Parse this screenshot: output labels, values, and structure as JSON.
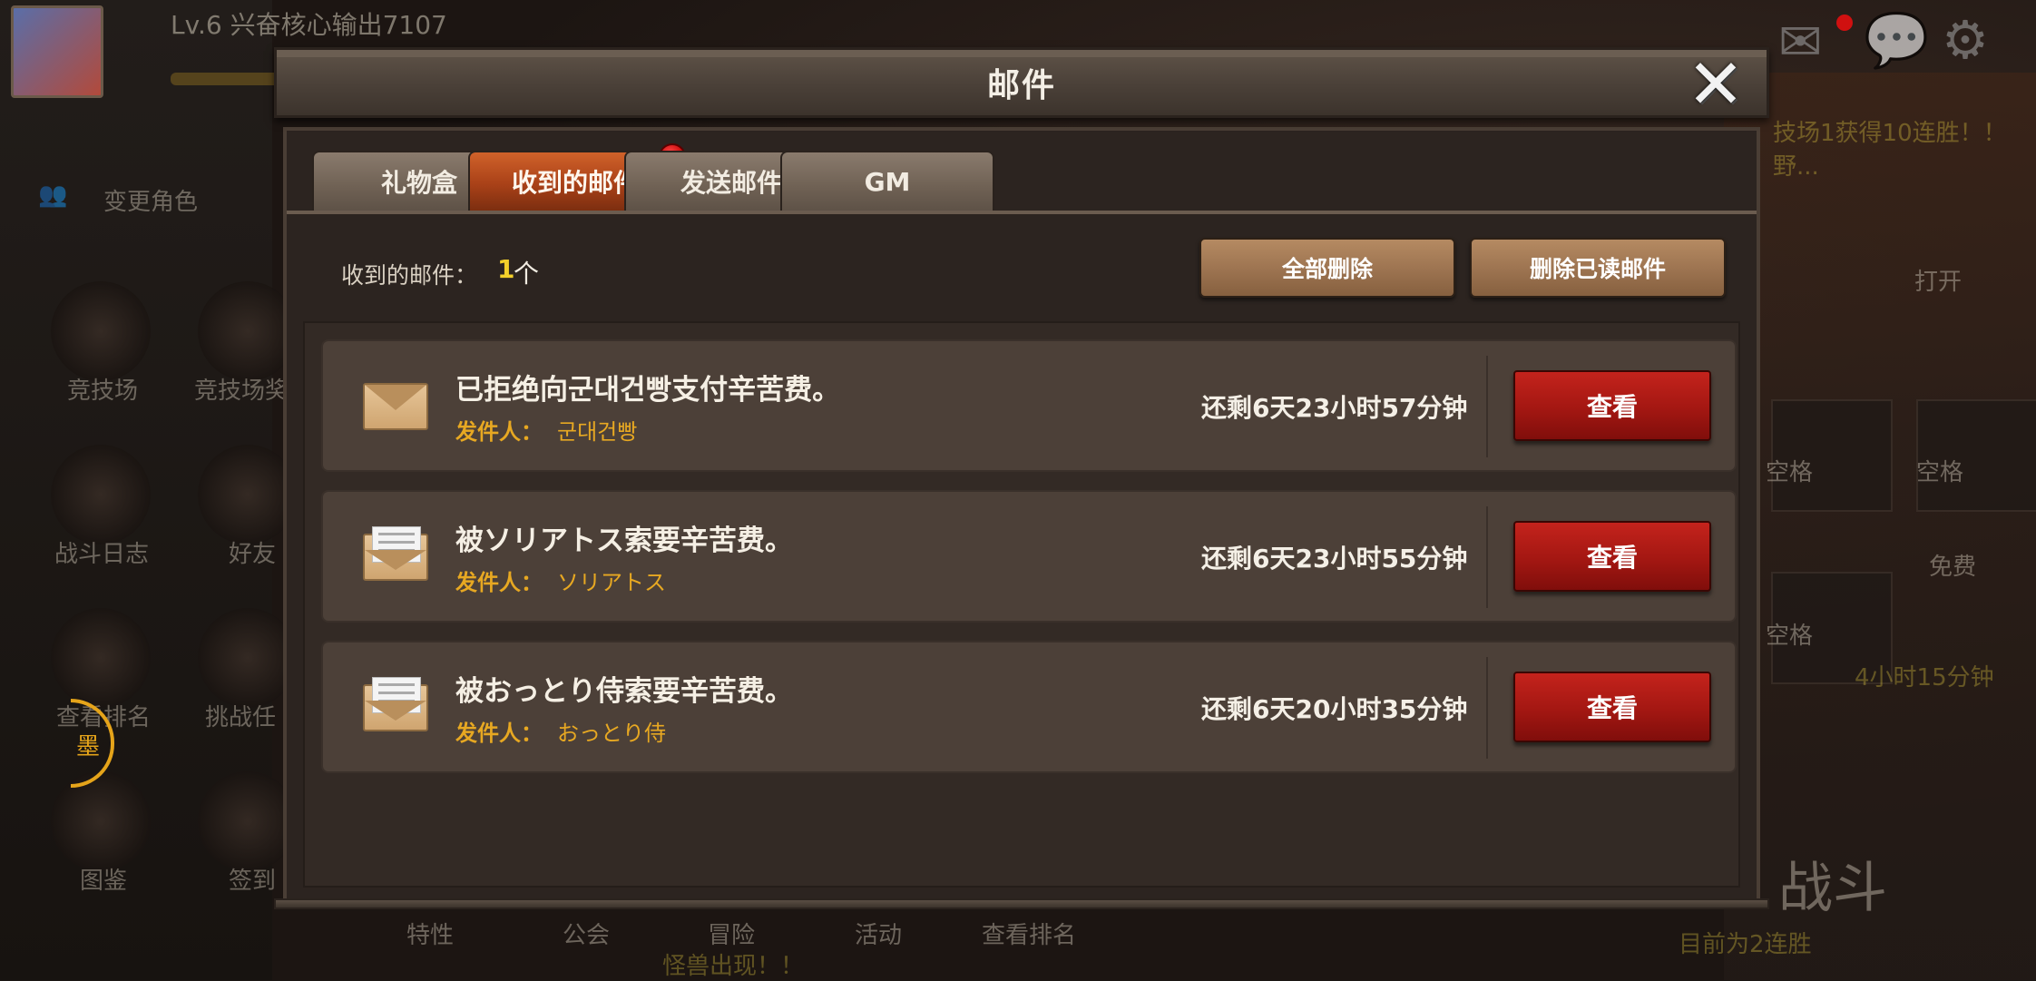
{
  "window": {
    "title": "邮件"
  },
  "tabs": [
    {
      "label": "礼物盒",
      "active": false
    },
    {
      "label": "收到的邮件",
      "active": true,
      "has_notification": true
    },
    {
      "label": "发送邮件",
      "active": false
    },
    {
      "label": "GM",
      "active": false
    }
  ],
  "summary": {
    "label": "收到的邮件：",
    "count": "1",
    "unit": "个"
  },
  "actions": {
    "delete_all": "全部删除",
    "delete_read": "删除已读邮件"
  },
  "mails": [
    {
      "title": "已拒绝向군대건빵支付辛苦费。",
      "sender_label": "发件人：",
      "sender": "군대건빵",
      "remaining": "还剩6天23小时57分钟",
      "button": "查看",
      "read": false
    },
    {
      "title": "被ソリアトス索要辛苦费。",
      "sender_label": "发件人：",
      "sender": "ソリアトス",
      "remaining": "还剩6天23小时55分钟",
      "button": "查看",
      "read": true
    },
    {
      "title": "被おっとり侍索要辛苦费。",
      "sender_label": "发件人：",
      "sender": "おっとり侍",
      "remaining": "还剩6天20小时35分钟",
      "button": "查看",
      "read": true
    }
  ],
  "background": {
    "player": "Lv.6 兴奋核心输出7107",
    "change_role": "变更角色",
    "menu_left": [
      "竞技场",
      "战斗日志",
      "图鉴"
    ],
    "menu_left2": [
      "竞技场奖",
      "好友",
      "挑战任",
      "签到"
    ],
    "menu_left3": "查看排名",
    "bottom_menu": [
      "特性",
      "公会",
      "冒险",
      "活动",
      "查看排名"
    ],
    "ink_char": "墨",
    "slot_label": "空格",
    "open_label": "打开",
    "free_label": "免费",
    "timer": "4小时15分钟",
    "battle": "战斗",
    "streak": "目前为2连胜",
    "ticker": "技场1获得10连胜！！野...",
    "monster": "怪兽出现！！"
  },
  "colors": {
    "accent_tab": "#b0471b",
    "view_button": "#a31712",
    "sender": "#e7a822",
    "count": "#f3d02a"
  }
}
